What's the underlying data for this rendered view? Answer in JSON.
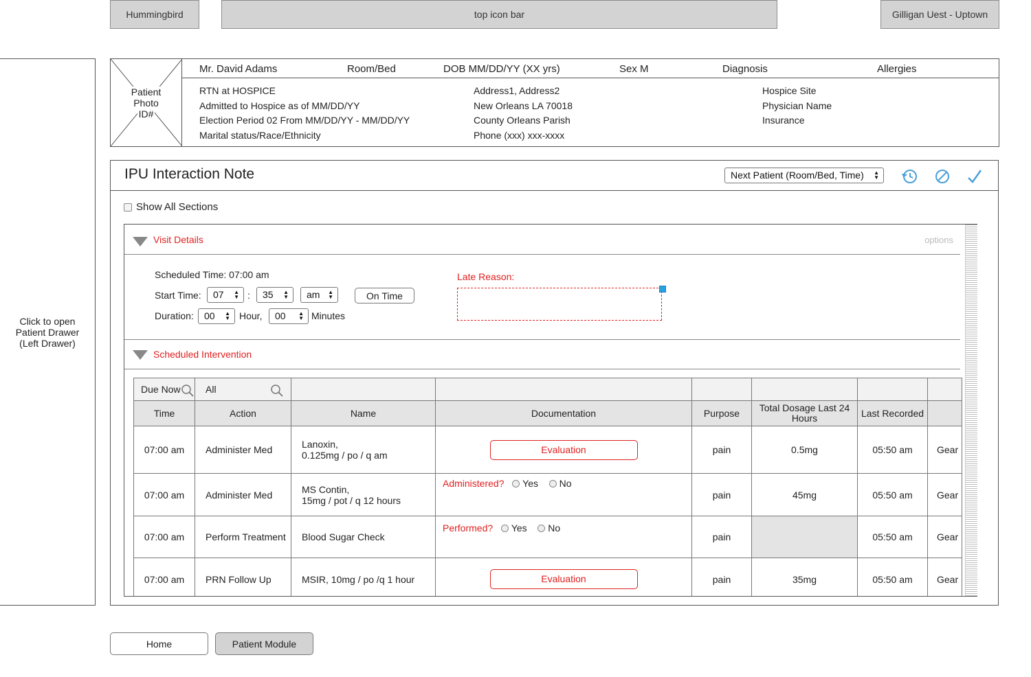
{
  "topbar": {
    "app_name": "Hummingbird",
    "icon_bar": "top icon bar",
    "user": "Gilligan Uest - Uptown"
  },
  "left_drawer": {
    "line1": "Click to open",
    "line2": "Patient Drawer",
    "line3": "(Left Drawer)"
  },
  "patient": {
    "photo": {
      "line1": "Patient",
      "line2": "Photo",
      "line3": "ID#"
    },
    "name": "Mr. David Adams",
    "room_bed": "Room/Bed",
    "dob": "DOB MM/DD/YY (XX yrs)",
    "sex": "Sex M",
    "diagnosis": "Diagnosis",
    "allergies": "Allergies",
    "col1": [
      "RTN at HOSPICE",
      "Admitted to Hospice as of MM/DD/YY",
      "Election Period 02 From MM/DD/YY - MM/DD/YY",
      "Marital status/Race/Ethnicity"
    ],
    "col2": [
      "Address1, Address2",
      "New Orleans LA 70018",
      "County Orleans Parish",
      "Phone (xxx) xxx-xxxx"
    ],
    "col3": [
      "Hospice Site",
      "Physician Name",
      "Insurance"
    ]
  },
  "note": {
    "title": "IPU Interaction Note",
    "next_patient": "Next Patient (Room/Bed, Time)",
    "show_all_sections": "Show All Sections",
    "options": "options",
    "history_icon": "history-icon",
    "cancel_icon": "cancel-icon",
    "check_icon": "checkmark-icon"
  },
  "visit_details": {
    "title": "Visit Details",
    "scheduled_time": "Scheduled Time: 07:00 am",
    "start_time_label": "Start Time:",
    "start_hour": "07",
    "colon": ":",
    "start_minute": "35",
    "start_ampm": "am",
    "on_time": "On Time",
    "duration_label": "Duration:",
    "duration_hours": "00",
    "hour_label": "Hour,",
    "duration_minutes": "00",
    "minutes_label": "Minutes",
    "late_reason_label": "Late Reason:"
  },
  "scheduled_intervention": {
    "title": "Scheduled Intervention",
    "filter": {
      "due_now": "Due Now",
      "all": "All"
    },
    "headers": [
      "Time",
      "Action",
      "Name",
      "Documentation",
      "Purpose",
      "Total Dosage Last 24 Hours",
      "Last Recorded",
      ""
    ],
    "rows": [
      {
        "time": "07:00 am",
        "action": "Administer Med",
        "name1": "Lanoxin,",
        "name2": "0.125mg / po / q am",
        "doc_button": "Evaluation",
        "purpose": "pain",
        "total": "0.5mg",
        "last": "05:50 am",
        "gear": "Gear"
      },
      {
        "time": "07:00 am",
        "action": "Administer Med",
        "name1": "MS Contin,",
        "name2": "15mg / pot / q 12 hours",
        "doc_question": "Administered?",
        "yes": "Yes",
        "no": "No",
        "purpose": "pain",
        "total": "45mg",
        "last": "05:50 am",
        "gear": "Gear"
      },
      {
        "time": "07:00 am",
        "action": "Perform Treatment",
        "name1": "Blood Sugar Check",
        "doc_question": "Performed?",
        "yes": "Yes",
        "no": "No",
        "purpose": "pain",
        "total": "",
        "last": "05:50 am",
        "gear": "Gear"
      },
      {
        "time": "07:00 am",
        "action": "PRN Follow Up",
        "name1": "MSIR, 10mg / po /q 1 hour",
        "doc_button": "Evaluation",
        "purpose": "pain",
        "total": "35mg",
        "last": "05:50 am",
        "gear": "Gear"
      }
    ]
  },
  "bottom": {
    "home": "Home",
    "patient_module": "Patient Module"
  }
}
